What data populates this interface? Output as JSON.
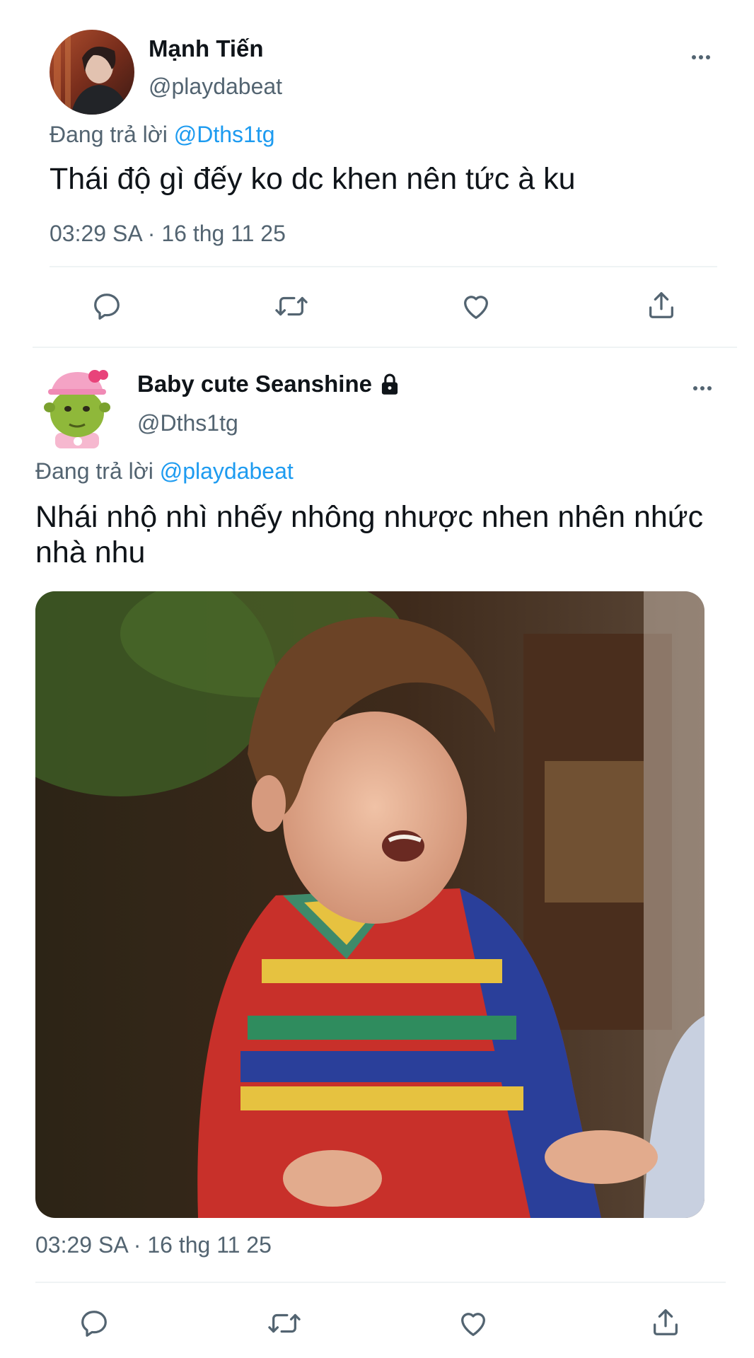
{
  "tweets": [
    {
      "display_name": "Mạnh Tiến",
      "handle": "@playdabeat",
      "reply_prefix": "Đang trả lời",
      "reply_to": "@Dths1tg",
      "text": "Thái độ gì đếy ko dc khen nên tức à ku",
      "timestamp": "03:29 SA · 16 thg 11 25"
    },
    {
      "display_name": "Baby cute Seanshine",
      "protected_icon": "lock-icon",
      "handle": "@Dths1tg",
      "reply_prefix": "Đang trả lời",
      "reply_to": "@playdabeat",
      "text_line1": "Nhái nhộ nhì nhếy nhông nhược nhen nhên nhức",
      "text_line2": "nhà nhu",
      "timestamp": "03:29 SA · 16 thg 11 25"
    }
  ],
  "actions": [
    "reply-icon",
    "retweet-icon",
    "like-icon",
    "share-icon"
  ],
  "colors": {
    "accent": "#1d9bf0",
    "secondary_text": "#536471",
    "primary_text": "#0f1419",
    "divider": "#eff3f4"
  }
}
